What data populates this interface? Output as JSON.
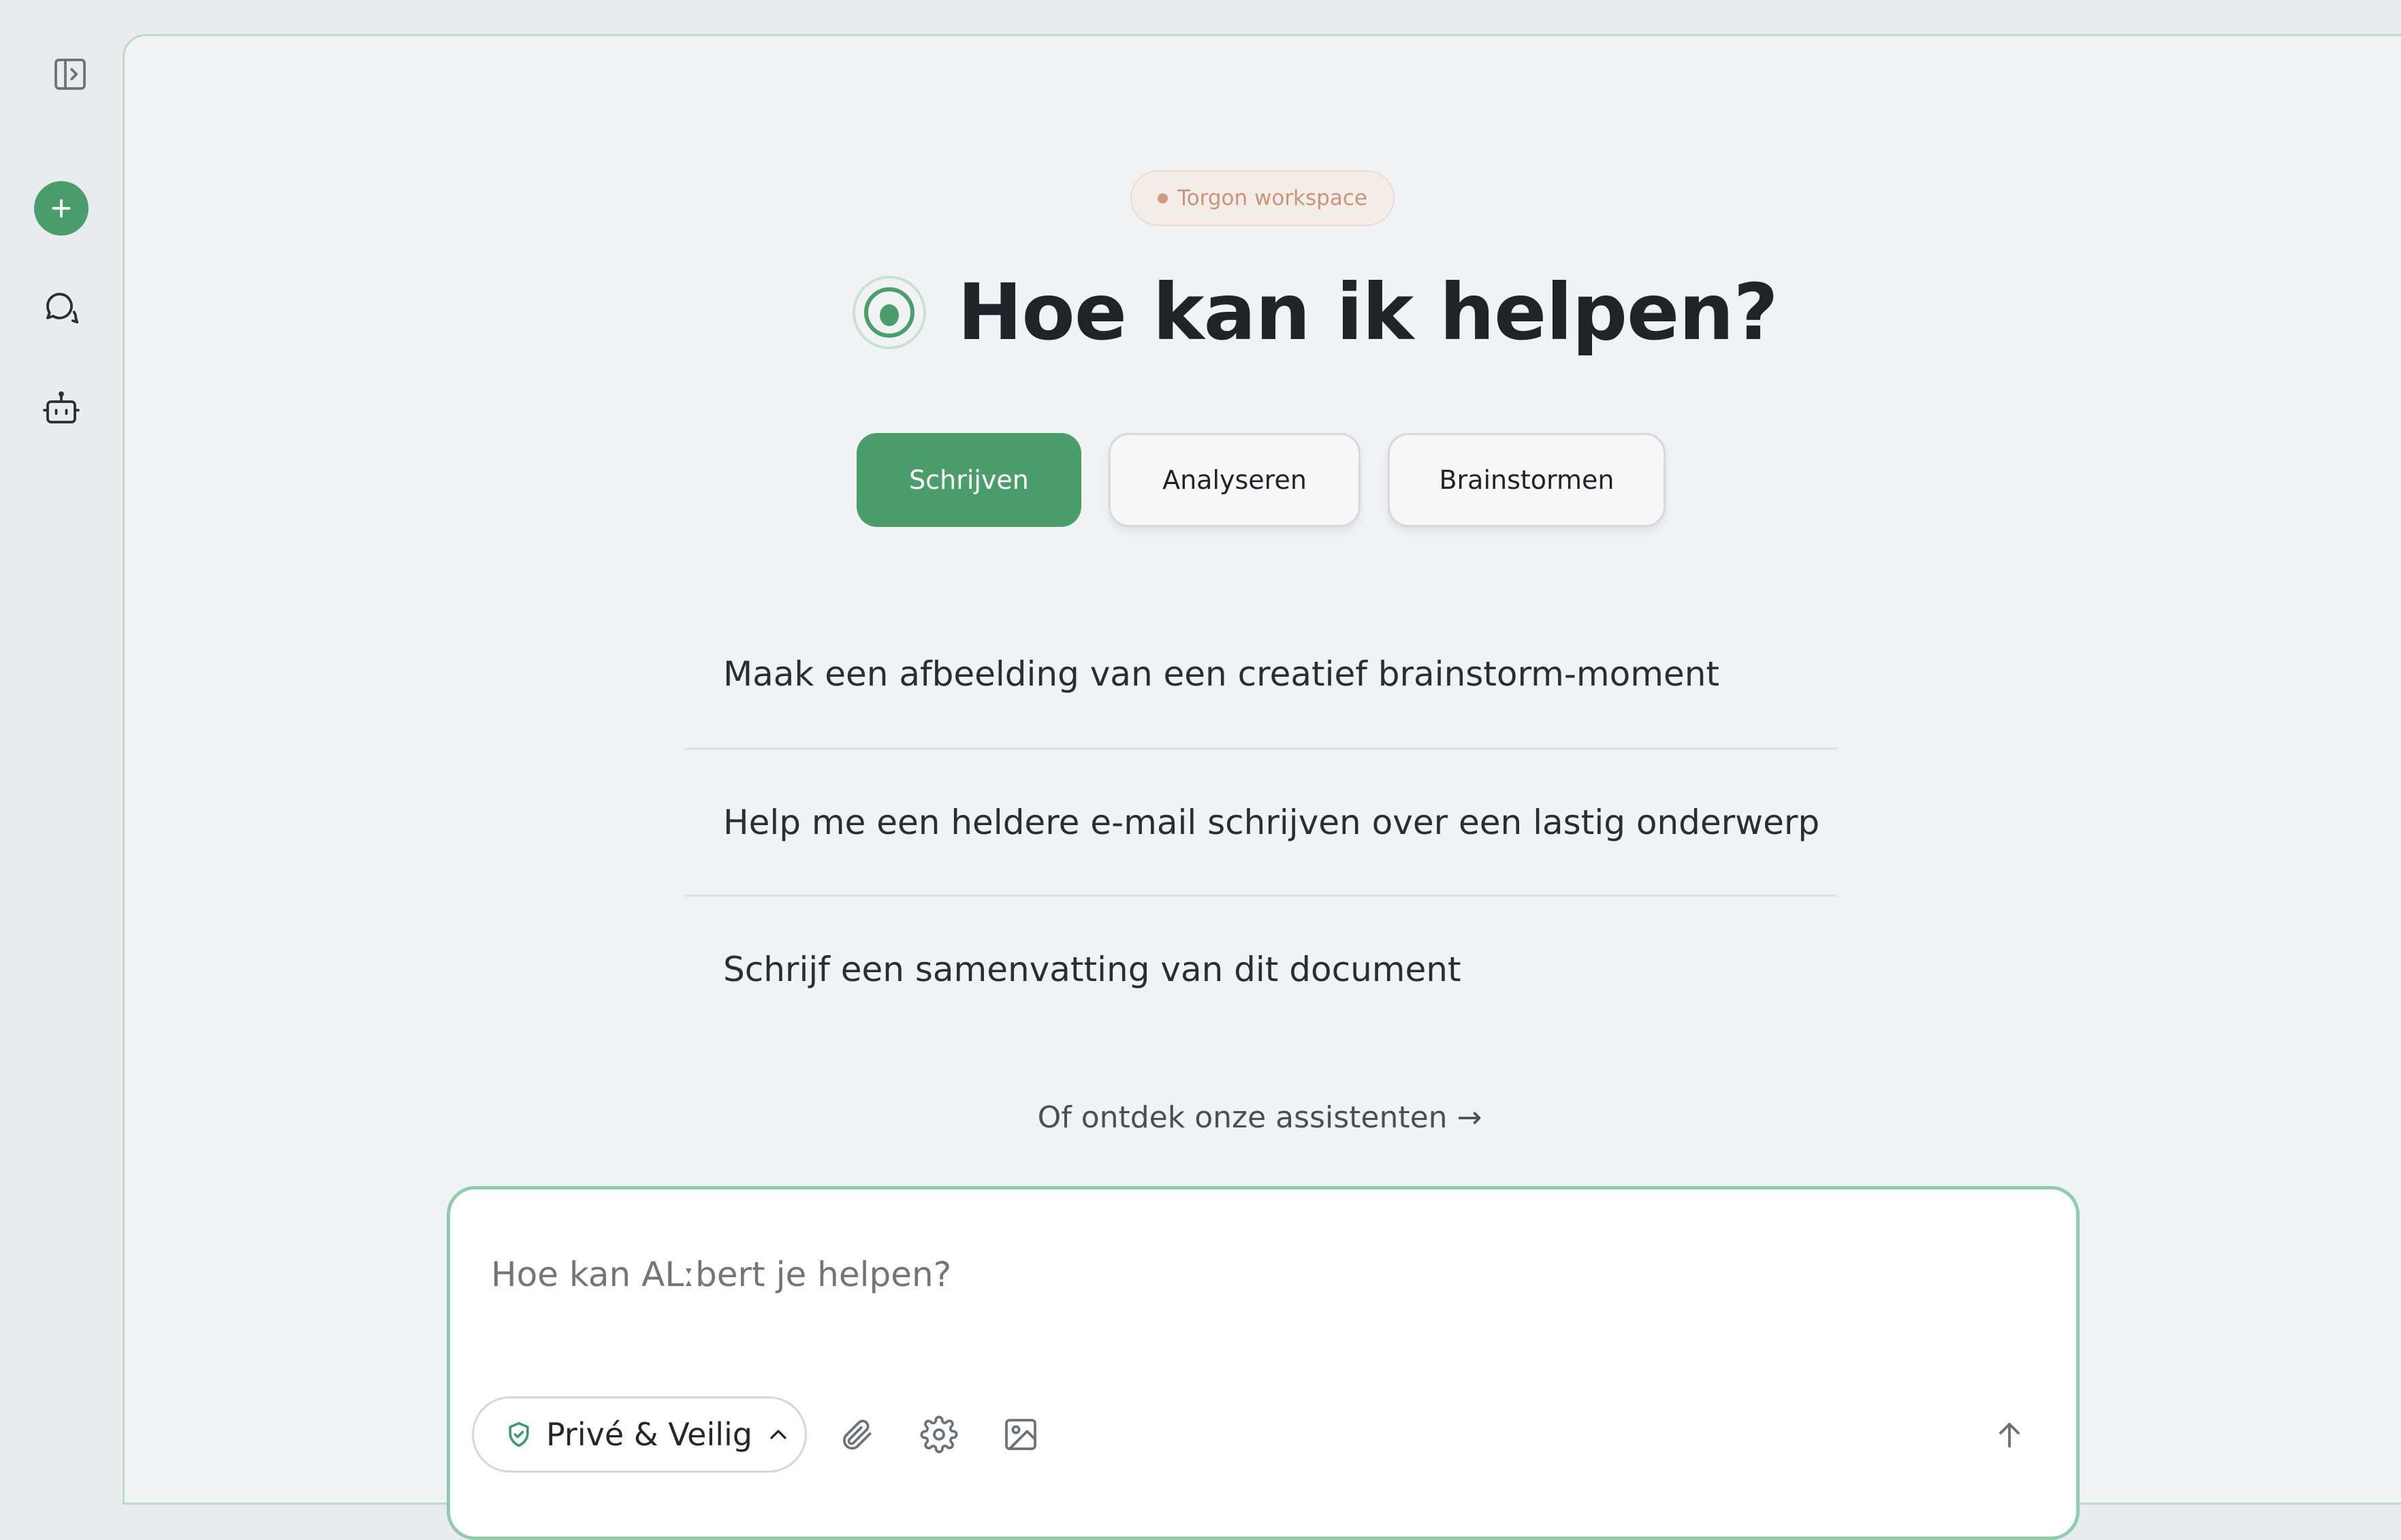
{
  "sidebar": {
    "toggle_icon": "sidebar-toggle-icon",
    "new_chat_icon": "plus-icon",
    "chats_icon": "chat-bubble-icon",
    "assistants_icon": "robot-icon",
    "accent": "#4b9d6c"
  },
  "main": {
    "workspace_badge": "Torgon workspace",
    "heading": "Hoe kan ik helpen?",
    "logo_icon": "target-logo-icon",
    "tabs": [
      {
        "label": "Schrijven",
        "active": true
      },
      {
        "label": "Analyseren",
        "active": false
      },
      {
        "label": "Brainstormen",
        "active": false
      }
    ],
    "suggestions": [
      "Maak een afbeelding van een creatief brainstorm-moment",
      "Help me een heldere e-mail schrijven over een lastig onderwerp",
      "Schrijf een samenvatting van dit document"
    ],
    "discover_link": "Of ontdek onze assistenten →"
  },
  "composer": {
    "placeholder": "Hoe kan ALːbert je helpen?",
    "privacy_label": "Privé & Veilig",
    "privacy_icon": "shield-check-icon",
    "tools": [
      "paperclip-icon",
      "gear-icon",
      "image-icon"
    ],
    "send_icon": "arrow-up-icon"
  },
  "colors": {
    "accent": "#4b9d6c",
    "badge_text": "#c8957b",
    "composer_border": "#8fccab"
  }
}
